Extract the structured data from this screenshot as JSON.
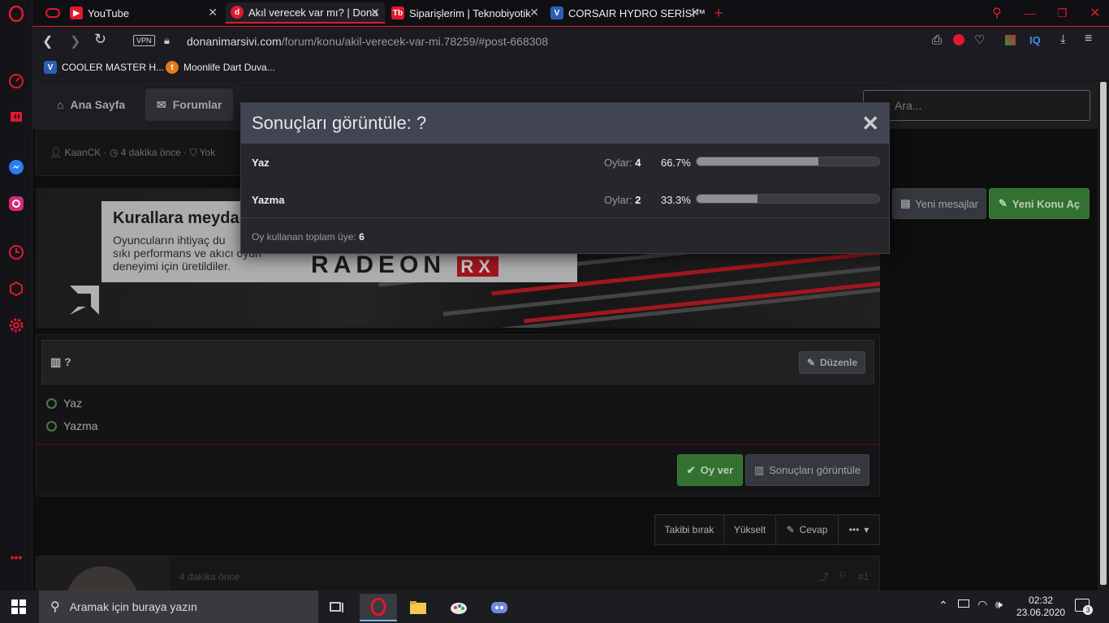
{
  "tabs": [
    {
      "label": "YouTube"
    },
    {
      "label": "Akıl verecek var mı? | Dona"
    },
    {
      "label": "Siparişlerim | Teknobiyotik"
    },
    {
      "label": "CORSAIR HYDRO SERİSİ™"
    }
  ],
  "address": {
    "vpn": "VPN",
    "domain": "donanimarsivi.com",
    "path": "/forum/konu/akil-verecek-var-mi.78259/#post-668308",
    "iq": "IQ"
  },
  "bookmarks": [
    {
      "label": "COOLER MASTER H..."
    },
    {
      "label": "Moonlife Dart Duva..."
    }
  ],
  "site_nav": {
    "home": "Ana Sayfa",
    "forums": "Forumlar",
    "search_placeholder": "Ara..."
  },
  "thread": {
    "author": "KaanCK",
    "time": "4 dakika önce",
    "tags": "Yok"
  },
  "buttons": {
    "new_messages": "Yeni mesajlar",
    "new_thread": "Yeni Konu Aç"
  },
  "banner": {
    "headline": "Kurallara meydan",
    "line1": "Oyuncuların ihtiyaç du",
    "line2": "sıkı performans ve akıcı oyun",
    "line3": "deneyimi için üretildiler.",
    "brand": "RADEON",
    "brand_suffix": "RX"
  },
  "poll": {
    "title": "?",
    "edit": "Düzenle",
    "options": [
      "Yaz",
      "Yazma"
    ],
    "vote_button": "Oy ver",
    "results_button": "Sonuçları görüntüle"
  },
  "thread_tools": {
    "unwatch": "Takibi bırak",
    "bump": "Yükselt",
    "reply": "Cevap",
    "more": "•••"
  },
  "post": {
    "time": "4 dakika önce",
    "number": "#1"
  },
  "modal": {
    "title": "Sonuçları görüntüle: ?",
    "votes_label": "Oylar:",
    "rows": [
      {
        "label": "Yaz",
        "votes": "4",
        "percent": "66.7%",
        "fraction": 0.667
      },
      {
        "label": "Yazma",
        "votes": "2",
        "percent": "33.3%",
        "fraction": 0.333
      }
    ],
    "footer_label": "Oy kullanan toplam üye:",
    "footer_total": "6"
  },
  "taskbar": {
    "search": "Aramak için buraya yazın",
    "time": "02:32",
    "date": "23.06.2020",
    "notifications": "3"
  },
  "colors": {
    "accent": "#e0192f",
    "green": "#3f8e3b",
    "bar_fill": "#8f9096"
  }
}
